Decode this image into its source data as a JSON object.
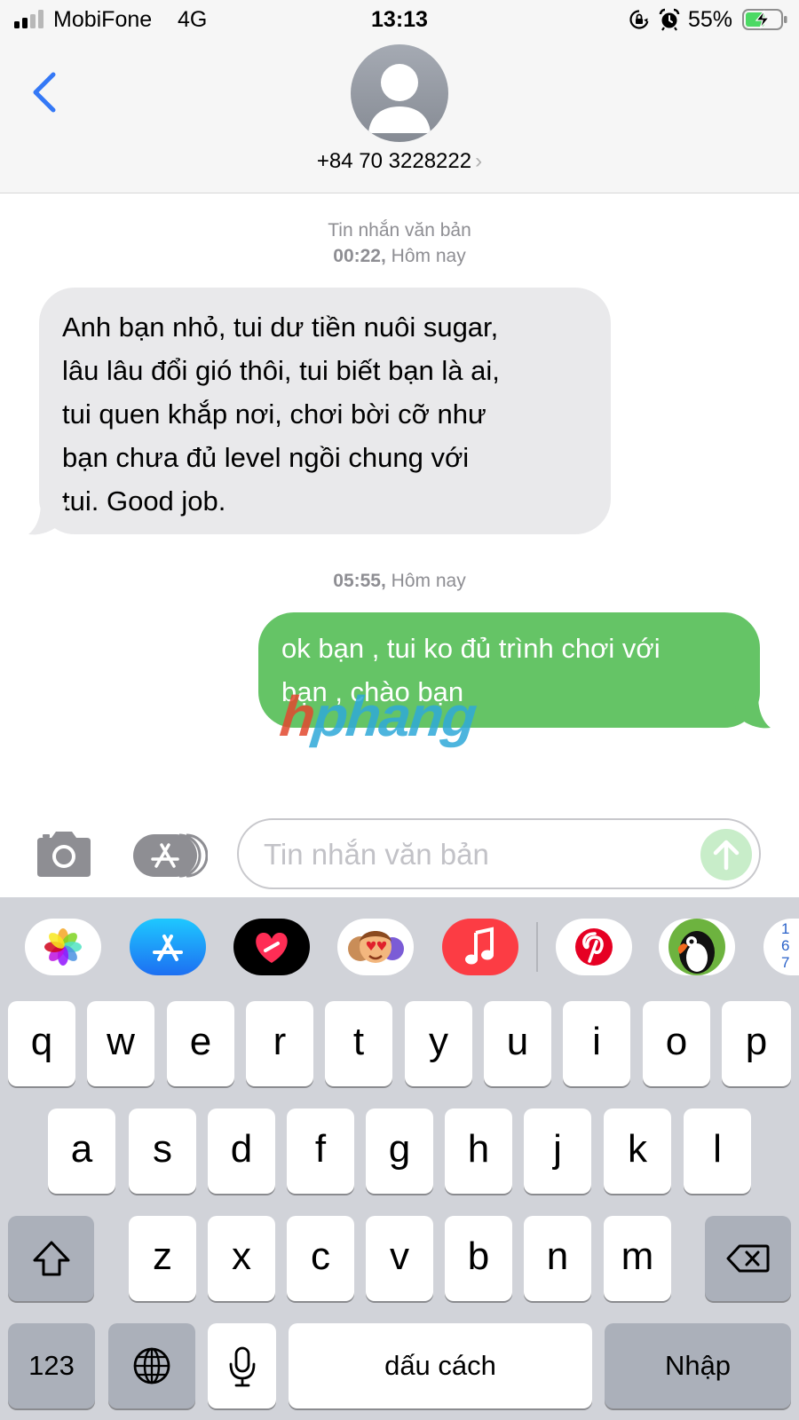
{
  "status_bar": {
    "carrier": "MobiFone",
    "network": "4G",
    "time": "13:13",
    "battery_percent": "55%",
    "battery_level": 0.55,
    "icons": [
      "signal-icon",
      "rotation-lock-icon",
      "alarm-icon",
      "battery-charging-icon"
    ]
  },
  "header": {
    "back_icon": "chevron-left-icon",
    "avatar_icon": "person-silhouette-icon",
    "contact": "+84 70 3228222",
    "contact_chevron": "›"
  },
  "conversation": {
    "messages_group_1": {
      "label": "Tin nhắn văn bản",
      "time": "00:22,",
      "day": "Hôm nay"
    },
    "received_message": {
      "lines": [
        "Anh bạn nhỏ, tui dư tiền nuôi sugar,",
        "lâu lâu đổi gió thôi, tui biết bạn là ai,",
        "tui quen khắp nơi, chơi bời cỡ như",
        "bạn chưa đủ level ngồi chung với",
        "tui. Good job."
      ]
    },
    "messages_group_2": {
      "time": "05:55,",
      "day": "Hôm nay"
    },
    "sent_message": {
      "lines": [
        "ok bạn , tui ko đủ trình chơi với",
        "bạn , chào bạn"
      ]
    },
    "watermark": {
      "part_a": "h",
      "part_b": "phang"
    }
  },
  "composer": {
    "placeholder": "Tin nhắn văn bản",
    "camera_icon": "camera-icon",
    "apps_icon": "app-store-icon",
    "send_icon": "arrow-up-icon"
  },
  "app_drawer": {
    "apps": [
      "photos-icon",
      "app-store-icon",
      "digital-touch-icon",
      "memoji-icon",
      "music-icon",
      "pinterest-icon",
      "puffin-sticker-icon",
      "sudoku-icon"
    ],
    "partial_app_digits": [
      "1",
      "6",
      "7"
    ]
  },
  "keyboard": {
    "row1": [
      "q",
      "w",
      "e",
      "r",
      "t",
      "y",
      "u",
      "i",
      "o",
      "p"
    ],
    "row2": [
      "a",
      "s",
      "d",
      "f",
      "g",
      "h",
      "j",
      "k",
      "l"
    ],
    "row3": [
      "z",
      "x",
      "c",
      "v",
      "b",
      "n",
      "m"
    ],
    "numbers_key": "123",
    "space_key": "dấu cách",
    "return_key": "Nhập",
    "icons": [
      "shift-icon",
      "delete-icon",
      "globe-icon",
      "microphone-icon"
    ]
  },
  "colors": {
    "sent_bubble": "#65c466",
    "received_bubble": "#e9e9eb",
    "accent": "#3478f6",
    "keyboard_bg": "#d1d3d9"
  }
}
